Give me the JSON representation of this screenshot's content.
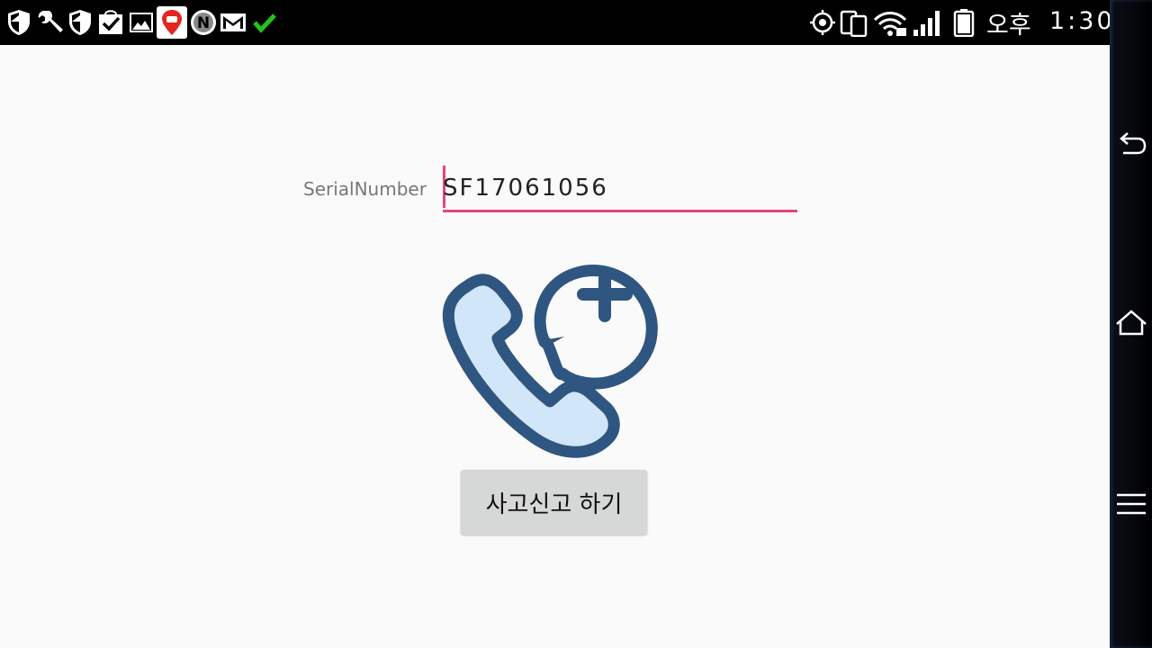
{
  "status_bar": {
    "left_icons": [
      "shield-icon",
      "wrench-icon",
      "shield-icon",
      "checkbox-bag-icon",
      "gallery-icon",
      "car-pin-icon",
      "n-badge-icon",
      "mail-icon",
      "check-icon"
    ],
    "right_icons": [
      "gps-icon",
      "phone-tablet-icon",
      "wifi-icon",
      "signal-icon",
      "battery-icon"
    ],
    "ampm": "오후",
    "time": "1:30"
  },
  "form": {
    "serial_label": "SerialNumber",
    "serial_value": "SF17061056",
    "accent_color": "#e8437b"
  },
  "report_icon": "phone-call-add-icon",
  "report_button_label": "사고신고 하기",
  "nav_bar": {
    "icons": [
      "back-icon",
      "home-icon",
      "menu-icon"
    ]
  }
}
